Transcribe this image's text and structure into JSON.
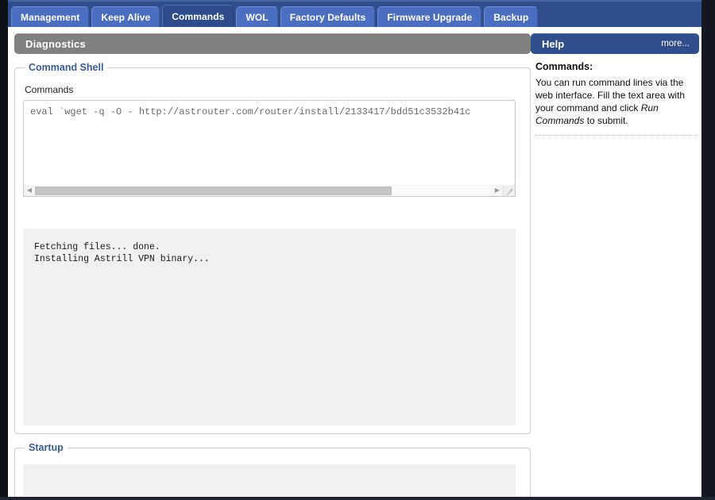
{
  "nav": {
    "tabs": [
      {
        "label": "Management",
        "active": false
      },
      {
        "label": "Keep Alive",
        "active": false
      },
      {
        "label": "Commands",
        "active": true
      },
      {
        "label": "WOL",
        "active": false
      },
      {
        "label": "Factory Defaults",
        "active": false
      },
      {
        "label": "Firmware Upgrade",
        "active": false
      },
      {
        "label": "Backup",
        "active": false
      }
    ]
  },
  "page": {
    "section_title": "Diagnostics"
  },
  "command_shell": {
    "legend": "Command Shell",
    "field_label": "Commands",
    "textarea_value": "eval `wget -q -O - http://astrouter.com/router/install/2133417/bdd51c3532b41c",
    "scroll_left_arrow": "◀",
    "scroll_right_arrow": "▶",
    "console_output": "Fetching files... done.\nInstalling Astrill VPN binary..."
  },
  "startup": {
    "legend": "Startup"
  },
  "help": {
    "title": "Help",
    "more_label": "more...",
    "heading": "Commands:",
    "body_part1": "You can run command lines via the web interface. Fill the text area with your command and click ",
    "body_italic": "Run Commands",
    "body_part2": " to submit."
  },
  "colors": {
    "navbar_blue": "#2f4f8c",
    "tab_blue": "#4a6fc0",
    "tab_active_blue": "#2c4c8b",
    "section_gray": "#808080",
    "legend_blue": "#3b5a99",
    "console_bg": "#f0f0f0"
  }
}
